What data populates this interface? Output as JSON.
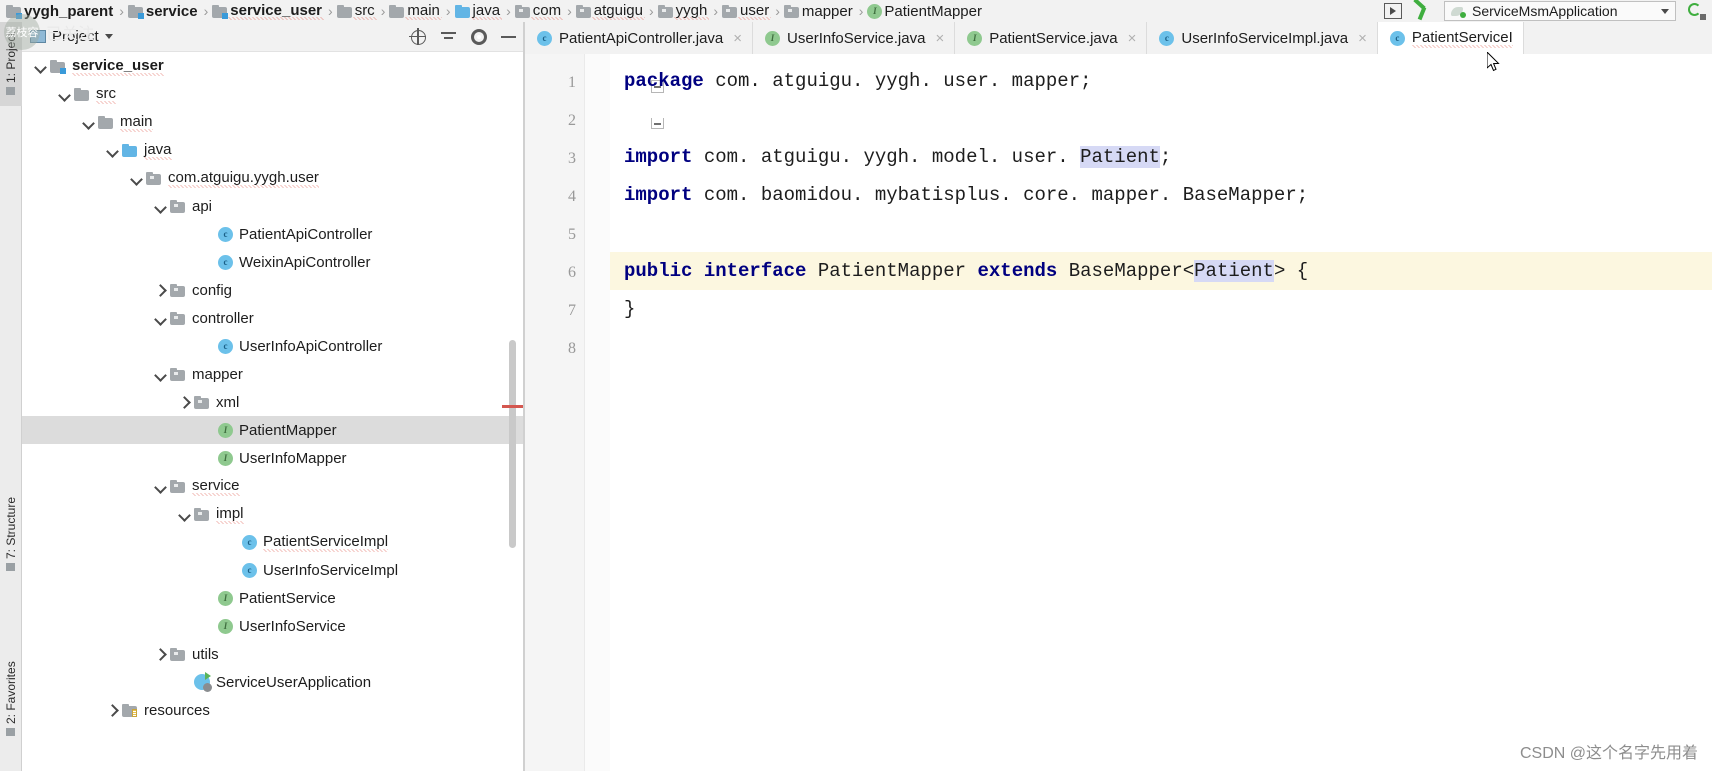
{
  "breadcrumbs": [
    {
      "label": "yygh_parent",
      "icon": "folder-module-icon",
      "bold": true,
      "spell": false
    },
    {
      "label": "service",
      "icon": "folder-module-icon",
      "bold": true,
      "spell": false
    },
    {
      "label": "service_user",
      "icon": "folder-module-icon",
      "bold": true,
      "spell": true
    },
    {
      "label": "src",
      "icon": "folder-icon",
      "bold": false,
      "spell": true
    },
    {
      "label": "main",
      "icon": "folder-icon",
      "bold": false,
      "spell": true
    },
    {
      "label": "java",
      "icon": "folder-source-icon",
      "bold": false,
      "spell": true
    },
    {
      "label": "com",
      "icon": "folder-package-icon",
      "bold": false,
      "spell": true
    },
    {
      "label": "atguigu",
      "icon": "folder-package-icon",
      "bold": false,
      "spell": true
    },
    {
      "label": "yygh",
      "icon": "folder-package-icon",
      "bold": false,
      "spell": true
    },
    {
      "label": "user",
      "icon": "folder-package-icon",
      "bold": false,
      "spell": true
    },
    {
      "label": "mapper",
      "icon": "folder-package-icon",
      "bold": false,
      "spell": false
    },
    {
      "label": "PatientMapper",
      "icon": "interface-icon",
      "bold": false,
      "spell": false
    }
  ],
  "navbar": {
    "run_config_label": "ServiceMsmApplication",
    "separator": "›"
  },
  "toolstrip": {
    "tabs": [
      {
        "label": "1: Project",
        "active": true
      },
      {
        "label": "7: Structure",
        "active": false
      },
      {
        "label": "2: Favorites",
        "active": false
      }
    ]
  },
  "project_panel": {
    "title": "Project",
    "tools": [
      "locate-icon",
      "collapse-all-icon",
      "settings-icon",
      "hide-icon"
    ],
    "tree": [
      {
        "label": "service_user",
        "icon": "folder-module-icon",
        "depth": 1,
        "arrow": "down",
        "bold": true,
        "spell": true,
        "selected": false
      },
      {
        "label": "src",
        "icon": "folder-icon",
        "depth": 2,
        "arrow": "down",
        "bold": false,
        "spell": true,
        "selected": false
      },
      {
        "label": "main",
        "icon": "folder-icon",
        "depth": 3,
        "arrow": "down",
        "bold": false,
        "spell": true,
        "selected": false
      },
      {
        "label": "java",
        "icon": "folder-source-icon",
        "depth": 4,
        "arrow": "down",
        "bold": false,
        "spell": true,
        "selected": false
      },
      {
        "label": "com.atguigu.yygh.user",
        "icon": "folder-package-icon",
        "depth": 5,
        "arrow": "down",
        "bold": false,
        "spell": true,
        "selected": false
      },
      {
        "label": "api",
        "icon": "folder-package-icon",
        "depth": 6,
        "arrow": "down",
        "bold": false,
        "spell": false,
        "selected": false
      },
      {
        "label": "PatientApiController",
        "icon": "class-icon",
        "depth": 8,
        "arrow": "none",
        "bold": false,
        "spell": false,
        "selected": false
      },
      {
        "label": "WeixinApiController",
        "icon": "class-icon",
        "depth": 8,
        "arrow": "none",
        "bold": false,
        "spell": false,
        "selected": false
      },
      {
        "label": "config",
        "icon": "folder-package-icon",
        "depth": 6,
        "arrow": "right",
        "bold": false,
        "spell": false,
        "selected": false
      },
      {
        "label": "controller",
        "icon": "folder-package-icon",
        "depth": 6,
        "arrow": "down",
        "bold": false,
        "spell": false,
        "selected": false
      },
      {
        "label": "UserInfoApiController",
        "icon": "class-icon",
        "depth": 8,
        "arrow": "none",
        "bold": false,
        "spell": false,
        "selected": false
      },
      {
        "label": "mapper",
        "icon": "folder-package-icon",
        "depth": 6,
        "arrow": "down",
        "bold": false,
        "spell": false,
        "selected": false
      },
      {
        "label": "xml",
        "icon": "folder-package-icon",
        "depth": 7,
        "arrow": "right",
        "bold": false,
        "spell": false,
        "selected": false
      },
      {
        "label": "PatientMapper",
        "icon": "interface-icon",
        "depth": 8,
        "arrow": "none",
        "bold": false,
        "spell": false,
        "selected": true
      },
      {
        "label": "UserInfoMapper",
        "icon": "interface-icon",
        "depth": 8,
        "arrow": "none",
        "bold": false,
        "spell": false,
        "selected": false
      },
      {
        "label": "service",
        "icon": "folder-package-icon",
        "depth": 6,
        "arrow": "down",
        "bold": false,
        "spell": true,
        "selected": false
      },
      {
        "label": "impl",
        "icon": "folder-package-icon",
        "depth": 7,
        "arrow": "down",
        "bold": false,
        "spell": true,
        "selected": false
      },
      {
        "label": "PatientServiceImpl",
        "icon": "class-icon",
        "depth": 9,
        "arrow": "none",
        "bold": false,
        "spell": true,
        "selected": false
      },
      {
        "label": "UserInfoServiceImpl",
        "icon": "class-icon",
        "depth": 9,
        "arrow": "none",
        "bold": false,
        "spell": false,
        "selected": false
      },
      {
        "label": "PatientService",
        "icon": "interface-icon",
        "depth": 8,
        "arrow": "none",
        "bold": false,
        "spell": false,
        "selected": false
      },
      {
        "label": "UserInfoService",
        "icon": "interface-icon",
        "depth": 8,
        "arrow": "none",
        "bold": false,
        "spell": false,
        "selected": false
      },
      {
        "label": "utils",
        "icon": "folder-package-icon",
        "depth": 6,
        "arrow": "right",
        "bold": false,
        "spell": false,
        "selected": false
      },
      {
        "label": "ServiceUserApplication",
        "icon": "spring-boot-icon",
        "depth": 7,
        "arrow": "none",
        "bold": false,
        "spell": false,
        "selected": false
      },
      {
        "label": "resources",
        "icon": "folder-resources-icon",
        "depth": 4,
        "arrow": "right",
        "bold": false,
        "spell": false,
        "selected": false
      }
    ]
  },
  "editor_tabs": [
    {
      "label": "PatientApiController.java",
      "icon": "class-icon",
      "active": false,
      "error": false
    },
    {
      "label": "UserInfoService.java",
      "icon": "interface-icon",
      "active": false,
      "error": false
    },
    {
      "label": "PatientService.java",
      "icon": "interface-icon",
      "active": false,
      "error": false
    },
    {
      "label": "UserInfoServiceImpl.java",
      "icon": "class-icon",
      "active": false,
      "error": false
    },
    {
      "label": "PatientServiceI",
      "icon": "class-icon",
      "active": true,
      "error": true
    }
  ],
  "editor": {
    "line_numbers": [
      "1",
      "2",
      "3",
      "4",
      "5",
      "6",
      "7",
      "8"
    ],
    "caret_line": 6,
    "lines": [
      {
        "n": 1,
        "segments": [
          {
            "t": "package",
            "k": true
          },
          {
            "t": " com. atguigu. yygh. user. mapper;",
            "k": false
          }
        ]
      },
      {
        "n": 2,
        "segments": []
      },
      {
        "n": 3,
        "segments": [
          {
            "t": "import",
            "k": true
          },
          {
            "t": " com. atguigu. yygh. model. user. ",
            "k": false
          },
          {
            "t": "Patient",
            "k": false,
            "hl": true
          },
          {
            "t": ";",
            "k": false
          }
        ]
      },
      {
        "n": 4,
        "segments": [
          {
            "t": "import",
            "k": true
          },
          {
            "t": " com. baomidou. mybatisplus. core. mapper. BaseMapper;",
            "k": false
          }
        ]
      },
      {
        "n": 5,
        "segments": []
      },
      {
        "n": 6,
        "segments": [
          {
            "t": "public",
            "k": true
          },
          {
            "t": " ",
            "k": false
          },
          {
            "t": "interface",
            "k": true
          },
          {
            "t": " PatientMapper ",
            "k": false
          },
          {
            "t": "extends",
            "k": true
          },
          {
            "t": " BaseMapper<",
            "k": false
          },
          {
            "t": "Patient",
            "k": false,
            "hl": true
          },
          {
            "t": "> {",
            "k": false
          }
        ]
      },
      {
        "n": 7,
        "segments": [
          {
            "t": "}",
            "k": false
          }
        ]
      },
      {
        "n": 8,
        "segments": []
      }
    ]
  },
  "watermarks": {
    "follow_badge": "已关注",
    "avatar_text": "荔枝容",
    "bottom_right": "CSDN @这个名字先用着"
  },
  "colors": {
    "accent_blue": "#3a9ad9",
    "keyword": "#000080",
    "selection_highlight": "#d6d9f5",
    "caret_line": "#fcf7e0",
    "tree_selection": "#dcdcdc",
    "error_red": "#e05a4f",
    "interface_green": "#8fc98f",
    "class_blue": "#6cc1ea"
  }
}
